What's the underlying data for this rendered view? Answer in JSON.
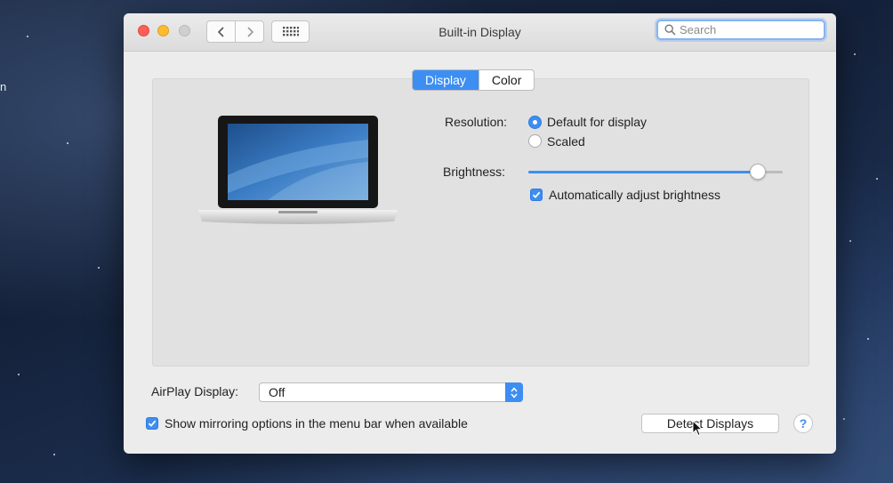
{
  "desktop": {
    "edge_label": "n"
  },
  "window": {
    "title": "Built-in Display"
  },
  "search": {
    "placeholder": "Search"
  },
  "tabs": [
    {
      "label": "Display",
      "active": true
    },
    {
      "label": "Color",
      "active": false
    }
  ],
  "resolution": {
    "label": "Resolution:",
    "options": [
      {
        "label": "Default for display",
        "selected": true
      },
      {
        "label": "Scaled",
        "selected": false
      }
    ]
  },
  "brightness": {
    "label": "Brightness:",
    "level": 0.93,
    "auto_adjust": {
      "label": "Automatically adjust brightness",
      "checked": true
    }
  },
  "airplay": {
    "label": "AirPlay Display:",
    "value": "Off"
  },
  "mirroring": {
    "label": "Show mirroring options in the menu bar when available",
    "checked": true
  },
  "buttons": {
    "detect": "Detect Displays",
    "help": "?"
  },
  "icons": [
    "back-icon",
    "forward-icon",
    "show-all-grid-icon",
    "search-icon",
    "laptop-icon",
    "checkmark-icon",
    "updown-arrows-icon",
    "cursor-icon"
  ],
  "colors": {
    "accent": "#3d8ef2",
    "close": "#fc5f57",
    "minimize": "#fdbc2e"
  }
}
